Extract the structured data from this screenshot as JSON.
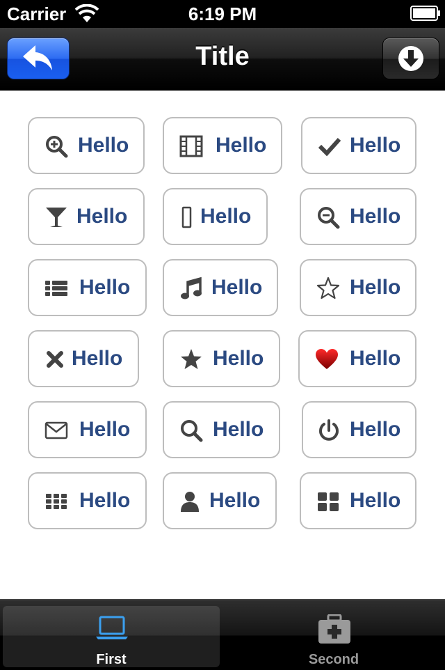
{
  "status_bar": {
    "carrier": "Carrier",
    "time": "6:19 PM"
  },
  "nav_bar": {
    "title": "Title",
    "left_icon": "reply-arrow-icon",
    "right_icon": "download-circle-icon"
  },
  "buttons": [
    {
      "label": "Hello",
      "icon": "zoom-in-icon"
    },
    {
      "label": "Hello",
      "icon": "film-icon"
    },
    {
      "label": "Hello",
      "icon": "checkmark-icon"
    },
    {
      "label": "Hello",
      "icon": "glass-icon"
    },
    {
      "label": "Hello",
      "icon": "mobile-phone-icon"
    },
    {
      "label": "Hello",
      "icon": "zoom-out-icon"
    },
    {
      "label": "Hello",
      "icon": "list-icon"
    },
    {
      "label": "Hello",
      "icon": "music-icon"
    },
    {
      "label": "Hello",
      "icon": "star-outline-icon"
    },
    {
      "label": "Hello",
      "icon": "close-icon"
    },
    {
      "label": "Hello",
      "icon": "star-filled-icon"
    },
    {
      "label": "Hello",
      "icon": "heart-icon"
    },
    {
      "label": "Hello",
      "icon": "envelope-icon"
    },
    {
      "label": "Hello",
      "icon": "search-icon"
    },
    {
      "label": "Hello",
      "icon": "power-icon"
    },
    {
      "label": "Hello",
      "icon": "grid-icon"
    },
    {
      "label": "Hello",
      "icon": "user-icon"
    },
    {
      "label": "Hello",
      "icon": "dashboard-icon"
    }
  ],
  "tab_bar": {
    "tabs": [
      {
        "label": "First",
        "icon": "laptop-icon",
        "selected": true
      },
      {
        "label": "Second",
        "icon": "first-aid-kit-icon",
        "selected": false
      }
    ]
  },
  "colors": {
    "label": "#2b4a82",
    "accent": "#3ba0f0",
    "back_button": "#1a5ff0"
  }
}
